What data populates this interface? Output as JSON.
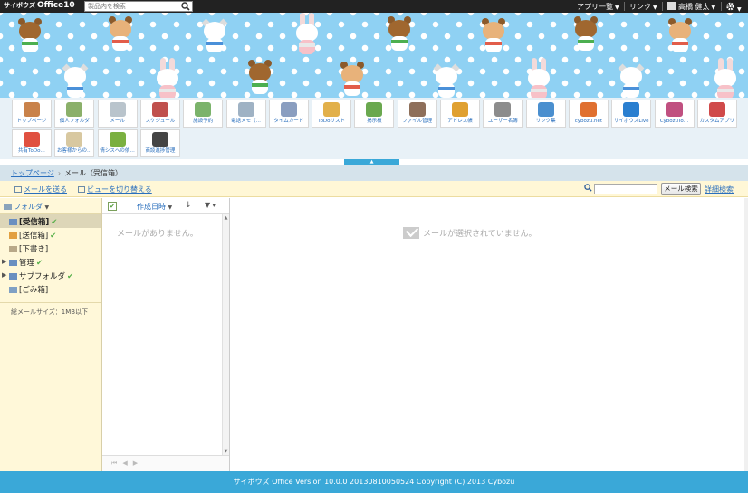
{
  "header": {
    "logo_prefix": "サイボウズ",
    "logo_main": "Office10",
    "search_placeholder": "製品内を検索",
    "menu_apps": "アプリ一覧",
    "menu_links": "リンク",
    "user_name": "高橋 健太"
  },
  "apps_row1": [
    {
      "label": "トップページ",
      "icon": "house-icon",
      "color": "#c9824a"
    },
    {
      "label": "個人フォルダ",
      "icon": "folder-photo-icon",
      "color": "#8bb06a"
    },
    {
      "label": "メール",
      "icon": "envelope-icon",
      "color": "#b9c4cc"
    },
    {
      "label": "スケジュール",
      "icon": "calendar-icon",
      "color": "#c0504d"
    },
    {
      "label": "施設予約",
      "icon": "facility-icon",
      "color": "#7bb36b"
    },
    {
      "label": "電話メモ（…",
      "icon": "phone-memo-icon",
      "color": "#9fb2c4"
    },
    {
      "label": "タイムカード",
      "icon": "timecard-icon",
      "color": "#8a9ec0"
    },
    {
      "label": "ToDoリスト",
      "icon": "todo-icon",
      "color": "#e2b04a"
    },
    {
      "label": "掲示板",
      "icon": "bulletin-board-icon",
      "color": "#6aa84f"
    },
    {
      "label": "ファイル管理",
      "icon": "file-cabinet-icon",
      "color": "#8e6f5a"
    },
    {
      "label": "アドレス帳",
      "icon": "address-book-icon",
      "color": "#e0a030"
    },
    {
      "label": "ユーザー名簿",
      "icon": "user-list-icon",
      "color": "#8c8c8c"
    },
    {
      "label": "リンク集",
      "icon": "globe-icon",
      "color": "#4a8fcf"
    },
    {
      "label": "cybozu.net",
      "icon": "cybozu-net-icon",
      "color": "#e07030"
    },
    {
      "label": "サイボウズLive",
      "icon": "live-icon",
      "color": "#2a7fd0"
    },
    {
      "label": "CybozuTo…",
      "icon": "plus-apps-icon",
      "color": "#c05080"
    },
    {
      "label": "カスタムアプリ",
      "icon": "custom-app-icon",
      "color": "#d04a4a"
    }
  ],
  "apps_row2": [
    {
      "label": "共有ToDo…",
      "icon": "shared-todo-icon",
      "color": "#e05040"
    },
    {
      "label": "お客様からの…",
      "icon": "customer-note-icon",
      "color": "#d8c8a0"
    },
    {
      "label": "情シスへの依…",
      "icon": "request-box-icon",
      "color": "#7ab040"
    },
    {
      "label": "商談進捗管理",
      "icon": "headset-icon",
      "color": "#444444"
    }
  ],
  "breadcrumb": {
    "home": "トップページ",
    "separator": "›",
    "current": "メール（受信箱）"
  },
  "actions": {
    "send_mail": "メールを送る",
    "switch_view": "ビューを切り替える",
    "search_button": "メール検索",
    "advanced_search": "詳細検索"
  },
  "folders": {
    "header": "フォルダ",
    "items": [
      {
        "label": "[受信箱]",
        "checked": true,
        "selected": true
      },
      {
        "label": "[送信箱]",
        "checked": true
      },
      {
        "label": "[下書き]",
        "checked": false
      },
      {
        "label": "管理",
        "checked": true
      },
      {
        "label": "サブフォルダ",
        "checked": true
      },
      {
        "label": "[ごみ箱]",
        "checked": false
      }
    ],
    "size_note": "総メールサイズ：1MB以下"
  },
  "list": {
    "sort_label": "作成日時",
    "empty_text": "メールがありません。"
  },
  "detail": {
    "empty_text": "メールが選択されていません。"
  },
  "footer": {
    "text": "サイボウズ Office Version 10.0.0 20130810050524 Copyright (C) 2013 Cybozu"
  },
  "colors": {
    "banner_bg": "#8fd1f3",
    "footer_bg": "#3aa8d8",
    "link": "#2a6fbd",
    "folder_pane_bg": "#fff8d9"
  }
}
